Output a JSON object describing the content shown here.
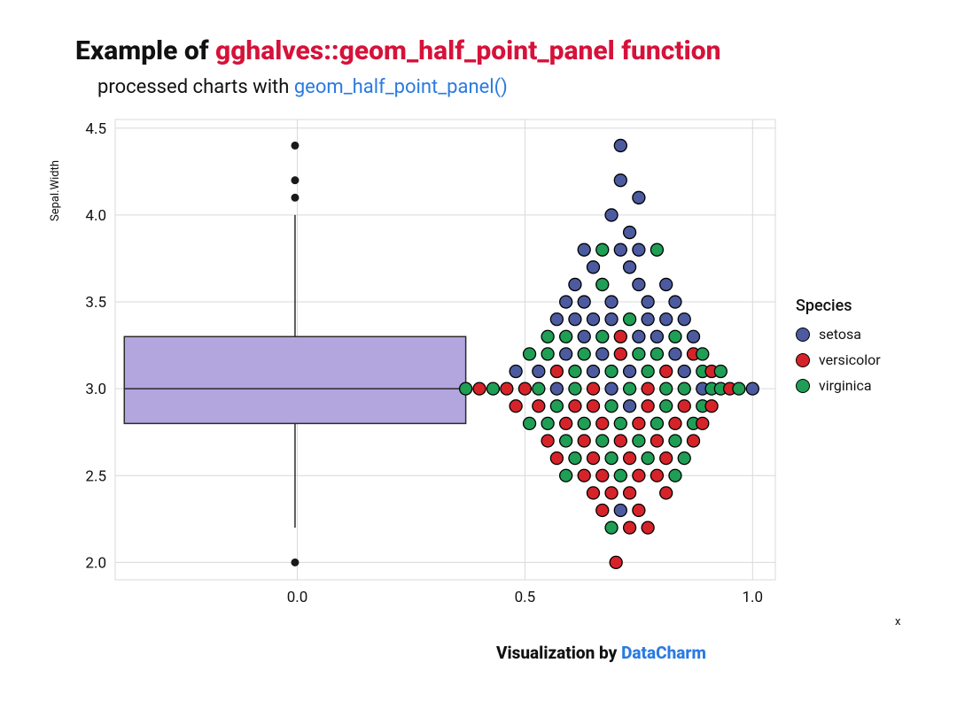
{
  "title_prefix": "Example of ",
  "title_hl": "gghalves::geom_half_point_panel function",
  "subtitle_prefix": "processed charts with ",
  "subtitle_hl": "geom_half_point_panel()",
  "caption_prefix": "Visualization by ",
  "caption_hl": "DataCharm",
  "y_axis_label": "Sepal.Width",
  "x_axis_label": "x",
  "legend_title": "Species",
  "legend_items": [
    {
      "name": "setosa",
      "color": "#4c5aa0"
    },
    {
      "name": "versicolor",
      "color": "#d6232a"
    },
    {
      "name": "virginica",
      "color": "#1f9e55"
    }
  ],
  "chart_data": {
    "type": "boxplot+jitter",
    "y_ticks": [
      2.0,
      2.5,
      3.0,
      3.5,
      4.0,
      4.5
    ],
    "x_ticks": [
      0.0,
      0.5,
      1.0
    ],
    "ylim": [
      1.9,
      4.55
    ],
    "xlim": [
      -0.4,
      1.05
    ],
    "box": {
      "x_left": -0.38,
      "x_right": 0.37,
      "q1": 2.8,
      "median": 3.0,
      "q3": 3.3,
      "whisker_low": 2.2,
      "whisker_high": 4.0,
      "outliers": [
        2.0,
        4.1,
        4.2,
        4.4
      ]
    },
    "series_colors": {
      "setosa": "#4c5aa0",
      "versicolor": "#d6232a",
      "virginica": "#1f9e55"
    },
    "points": [
      {
        "x": 0.37,
        "y": 3.0,
        "s": "virginica"
      },
      {
        "x": 0.4,
        "y": 3.0,
        "s": "versicolor"
      },
      {
        "x": 0.43,
        "y": 3.0,
        "s": "virginica"
      },
      {
        "x": 0.46,
        "y": 3.0,
        "s": "versicolor"
      },
      {
        "x": 0.48,
        "y": 2.9,
        "s": "versicolor"
      },
      {
        "x": 0.48,
        "y": 3.1,
        "s": "setosa"
      },
      {
        "x": 0.5,
        "y": 3.0,
        "s": "versicolor"
      },
      {
        "x": 0.51,
        "y": 2.8,
        "s": "virginica"
      },
      {
        "x": 0.51,
        "y": 3.2,
        "s": "virginica"
      },
      {
        "x": 0.53,
        "y": 2.9,
        "s": "versicolor"
      },
      {
        "x": 0.53,
        "y": 3.0,
        "s": "virginica"
      },
      {
        "x": 0.53,
        "y": 3.1,
        "s": "setosa"
      },
      {
        "x": 0.55,
        "y": 2.7,
        "s": "versicolor"
      },
      {
        "x": 0.55,
        "y": 2.8,
        "s": "virginica"
      },
      {
        "x": 0.55,
        "y": 3.2,
        "s": "virginica"
      },
      {
        "x": 0.55,
        "y": 3.3,
        "s": "virginica"
      },
      {
        "x": 0.57,
        "y": 2.6,
        "s": "versicolor"
      },
      {
        "x": 0.57,
        "y": 2.9,
        "s": "virginica"
      },
      {
        "x": 0.57,
        "y": 3.0,
        "s": "setosa"
      },
      {
        "x": 0.57,
        "y": 3.1,
        "s": "versicolor"
      },
      {
        "x": 0.57,
        "y": 3.4,
        "s": "setosa"
      },
      {
        "x": 0.59,
        "y": 2.5,
        "s": "virginica"
      },
      {
        "x": 0.59,
        "y": 2.7,
        "s": "virginica"
      },
      {
        "x": 0.59,
        "y": 2.8,
        "s": "versicolor"
      },
      {
        "x": 0.59,
        "y": 3.2,
        "s": "setosa"
      },
      {
        "x": 0.59,
        "y": 3.3,
        "s": "virginica"
      },
      {
        "x": 0.59,
        "y": 3.5,
        "s": "setosa"
      },
      {
        "x": 0.61,
        "y": 2.6,
        "s": "virginica"
      },
      {
        "x": 0.61,
        "y": 2.9,
        "s": "versicolor"
      },
      {
        "x": 0.61,
        "y": 3.0,
        "s": "virginica"
      },
      {
        "x": 0.61,
        "y": 3.1,
        "s": "virginica"
      },
      {
        "x": 0.61,
        "y": 3.4,
        "s": "setosa"
      },
      {
        "x": 0.61,
        "y": 3.6,
        "s": "setosa"
      },
      {
        "x": 0.63,
        "y": 2.5,
        "s": "versicolor"
      },
      {
        "x": 0.63,
        "y": 2.7,
        "s": "versicolor"
      },
      {
        "x": 0.63,
        "y": 2.8,
        "s": "virginica"
      },
      {
        "x": 0.63,
        "y": 3.2,
        "s": "virginica"
      },
      {
        "x": 0.63,
        "y": 3.3,
        "s": "setosa"
      },
      {
        "x": 0.63,
        "y": 3.5,
        "s": "setosa"
      },
      {
        "x": 0.63,
        "y": 3.8,
        "s": "setosa"
      },
      {
        "x": 0.65,
        "y": 2.4,
        "s": "versicolor"
      },
      {
        "x": 0.65,
        "y": 2.6,
        "s": "versicolor"
      },
      {
        "x": 0.65,
        "y": 2.9,
        "s": "versicolor"
      },
      {
        "x": 0.65,
        "y": 3.0,
        "s": "versicolor"
      },
      {
        "x": 0.65,
        "y": 3.1,
        "s": "setosa"
      },
      {
        "x": 0.65,
        "y": 3.4,
        "s": "setosa"
      },
      {
        "x": 0.65,
        "y": 3.7,
        "s": "setosa"
      },
      {
        "x": 0.67,
        "y": 2.3,
        "s": "versicolor"
      },
      {
        "x": 0.67,
        "y": 2.5,
        "s": "versicolor"
      },
      {
        "x": 0.67,
        "y": 2.7,
        "s": "virginica"
      },
      {
        "x": 0.67,
        "y": 2.8,
        "s": "versicolor"
      },
      {
        "x": 0.67,
        "y": 3.2,
        "s": "setosa"
      },
      {
        "x": 0.67,
        "y": 3.3,
        "s": "virginica"
      },
      {
        "x": 0.67,
        "y": 3.6,
        "s": "virginica"
      },
      {
        "x": 0.67,
        "y": 3.8,
        "s": "virginica"
      },
      {
        "x": 0.69,
        "y": 2.2,
        "s": "virginica"
      },
      {
        "x": 0.69,
        "y": 2.4,
        "s": "versicolor"
      },
      {
        "x": 0.69,
        "y": 2.6,
        "s": "virginica"
      },
      {
        "x": 0.69,
        "y": 2.9,
        "s": "virginica"
      },
      {
        "x": 0.69,
        "y": 3.0,
        "s": "setosa"
      },
      {
        "x": 0.69,
        "y": 3.1,
        "s": "virginica"
      },
      {
        "x": 0.69,
        "y": 3.4,
        "s": "setosa"
      },
      {
        "x": 0.69,
        "y": 3.5,
        "s": "setosa"
      },
      {
        "x": 0.69,
        "y": 4.0,
        "s": "setosa"
      },
      {
        "x": 0.7,
        "y": 2.0,
        "s": "versicolor"
      },
      {
        "x": 0.71,
        "y": 2.3,
        "s": "setosa"
      },
      {
        "x": 0.71,
        "y": 2.5,
        "s": "virginica"
      },
      {
        "x": 0.71,
        "y": 2.7,
        "s": "versicolor"
      },
      {
        "x": 0.71,
        "y": 2.8,
        "s": "virginica"
      },
      {
        "x": 0.71,
        "y": 3.2,
        "s": "versicolor"
      },
      {
        "x": 0.71,
        "y": 3.3,
        "s": "versicolor"
      },
      {
        "x": 0.71,
        "y": 3.8,
        "s": "setosa"
      },
      {
        "x": 0.71,
        "y": 4.2,
        "s": "setosa"
      },
      {
        "x": 0.71,
        "y": 4.4,
        "s": "setosa"
      },
      {
        "x": 0.73,
        "y": 2.2,
        "s": "versicolor"
      },
      {
        "x": 0.73,
        "y": 2.4,
        "s": "versicolor"
      },
      {
        "x": 0.73,
        "y": 2.6,
        "s": "versicolor"
      },
      {
        "x": 0.73,
        "y": 2.9,
        "s": "setosa"
      },
      {
        "x": 0.73,
        "y": 3.0,
        "s": "virginica"
      },
      {
        "x": 0.73,
        "y": 3.1,
        "s": "setosa"
      },
      {
        "x": 0.73,
        "y": 3.4,
        "s": "virginica"
      },
      {
        "x": 0.73,
        "y": 3.7,
        "s": "setosa"
      },
      {
        "x": 0.73,
        "y": 3.9,
        "s": "setosa"
      },
      {
        "x": 0.75,
        "y": 2.3,
        "s": "versicolor"
      },
      {
        "x": 0.75,
        "y": 2.5,
        "s": "versicolor"
      },
      {
        "x": 0.75,
        "y": 2.7,
        "s": "virginica"
      },
      {
        "x": 0.75,
        "y": 2.8,
        "s": "versicolor"
      },
      {
        "x": 0.75,
        "y": 3.2,
        "s": "virginica"
      },
      {
        "x": 0.75,
        "y": 3.3,
        "s": "setosa"
      },
      {
        "x": 0.75,
        "y": 3.6,
        "s": "setosa"
      },
      {
        "x": 0.75,
        "y": 3.8,
        "s": "setosa"
      },
      {
        "x": 0.75,
        "y": 4.1,
        "s": "setosa"
      },
      {
        "x": 0.77,
        "y": 2.2,
        "s": "versicolor"
      },
      {
        "x": 0.77,
        "y": 2.6,
        "s": "virginica"
      },
      {
        "x": 0.77,
        "y": 2.9,
        "s": "versicolor"
      },
      {
        "x": 0.77,
        "y": 3.0,
        "s": "versicolor"
      },
      {
        "x": 0.77,
        "y": 3.1,
        "s": "virginica"
      },
      {
        "x": 0.77,
        "y": 3.4,
        "s": "setosa"
      },
      {
        "x": 0.77,
        "y": 3.5,
        "s": "setosa"
      },
      {
        "x": 0.79,
        "y": 2.5,
        "s": "versicolor"
      },
      {
        "x": 0.79,
        "y": 2.7,
        "s": "versicolor"
      },
      {
        "x": 0.79,
        "y": 2.8,
        "s": "virginica"
      },
      {
        "x": 0.79,
        "y": 3.2,
        "s": "virginica"
      },
      {
        "x": 0.79,
        "y": 3.3,
        "s": "setosa"
      },
      {
        "x": 0.79,
        "y": 3.8,
        "s": "virginica"
      },
      {
        "x": 0.81,
        "y": 2.4,
        "s": "versicolor"
      },
      {
        "x": 0.81,
        "y": 2.6,
        "s": "versicolor"
      },
      {
        "x": 0.81,
        "y": 2.9,
        "s": "virginica"
      },
      {
        "x": 0.81,
        "y": 3.0,
        "s": "virginica"
      },
      {
        "x": 0.81,
        "y": 3.1,
        "s": "versicolor"
      },
      {
        "x": 0.81,
        "y": 3.4,
        "s": "setosa"
      },
      {
        "x": 0.81,
        "y": 3.6,
        "s": "setosa"
      },
      {
        "x": 0.83,
        "y": 2.5,
        "s": "virginica"
      },
      {
        "x": 0.83,
        "y": 2.7,
        "s": "virginica"
      },
      {
        "x": 0.83,
        "y": 2.8,
        "s": "versicolor"
      },
      {
        "x": 0.83,
        "y": 3.2,
        "s": "setosa"
      },
      {
        "x": 0.83,
        "y": 3.3,
        "s": "virginica"
      },
      {
        "x": 0.83,
        "y": 3.5,
        "s": "setosa"
      },
      {
        "x": 0.85,
        "y": 2.6,
        "s": "virginica"
      },
      {
        "x": 0.85,
        "y": 2.9,
        "s": "versicolor"
      },
      {
        "x": 0.85,
        "y": 3.0,
        "s": "virginica"
      },
      {
        "x": 0.85,
        "y": 3.1,
        "s": "setosa"
      },
      {
        "x": 0.85,
        "y": 3.4,
        "s": "setosa"
      },
      {
        "x": 0.87,
        "y": 2.7,
        "s": "versicolor"
      },
      {
        "x": 0.87,
        "y": 2.8,
        "s": "virginica"
      },
      {
        "x": 0.87,
        "y": 3.2,
        "s": "versicolor"
      },
      {
        "x": 0.87,
        "y": 3.3,
        "s": "setosa"
      },
      {
        "x": 0.89,
        "y": 2.8,
        "s": "versicolor"
      },
      {
        "x": 0.89,
        "y": 2.9,
        "s": "virginica"
      },
      {
        "x": 0.89,
        "y": 3.0,
        "s": "setosa"
      },
      {
        "x": 0.89,
        "y": 3.1,
        "s": "virginica"
      },
      {
        "x": 0.89,
        "y": 3.2,
        "s": "virginica"
      },
      {
        "x": 0.91,
        "y": 2.9,
        "s": "versicolor"
      },
      {
        "x": 0.91,
        "y": 3.0,
        "s": "virginica"
      },
      {
        "x": 0.91,
        "y": 3.1,
        "s": "versicolor"
      },
      {
        "x": 0.93,
        "y": 3.0,
        "s": "virginica"
      },
      {
        "x": 0.93,
        "y": 3.1,
        "s": "virginica"
      },
      {
        "x": 0.95,
        "y": 3.0,
        "s": "versicolor"
      },
      {
        "x": 0.97,
        "y": 3.0,
        "s": "virginica"
      },
      {
        "x": 1.0,
        "y": 3.0,
        "s": "setosa"
      }
    ]
  }
}
